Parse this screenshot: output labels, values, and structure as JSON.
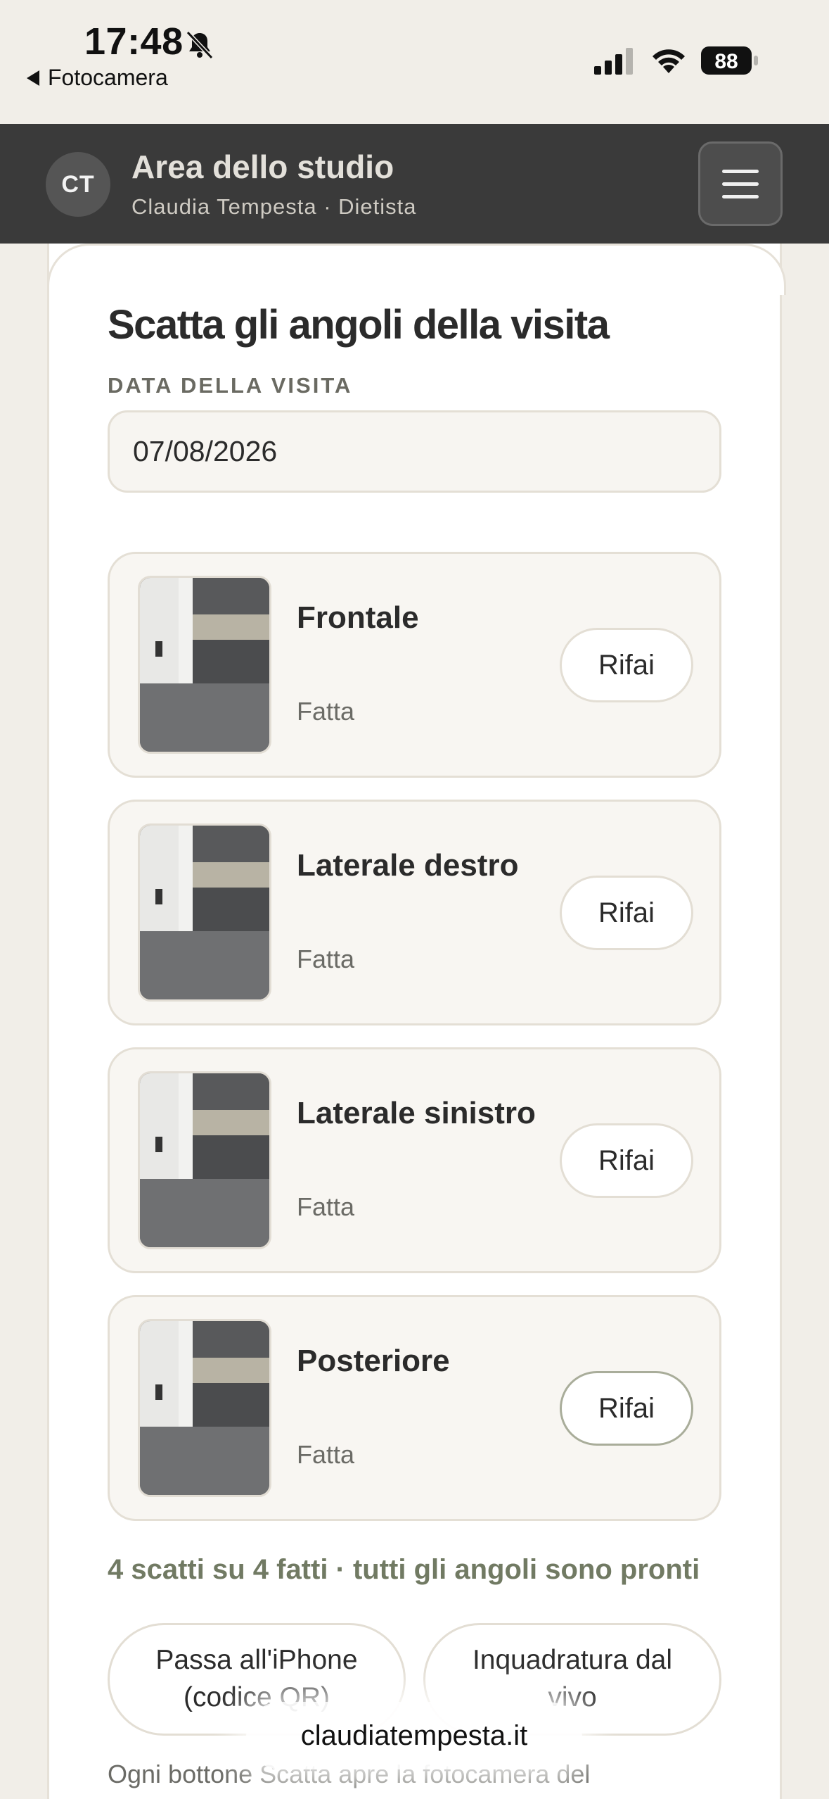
{
  "status_bar": {
    "time": "17:48",
    "back_label": "Fotocamera",
    "battery": "88",
    "icons": [
      "bell-slash-icon",
      "cellular-signal-icon",
      "wifi-icon",
      "battery-icon"
    ]
  },
  "header": {
    "avatar_initials": "CT",
    "title": "Area dello studio",
    "subtitle": "Claudia Tempesta · Dietista",
    "menu_icon": "hamburger-menu-icon",
    "background": "#3a3a3a"
  },
  "main": {
    "title": "Scatta gli angoli della visita",
    "date_label": "DATA DELLA VISITA",
    "date_value": "07/08/2026",
    "shots": [
      {
        "name": "Frontale",
        "status": "Fatta",
        "action": "Rifai"
      },
      {
        "name": "Laterale destro",
        "status": "Fatta",
        "action": "Rifai"
      },
      {
        "name": "Laterale sinistro",
        "status": "Fatta",
        "action": "Rifai"
      },
      {
        "name": "Posteriore",
        "status": "Fatta",
        "action": "Rifai"
      }
    ],
    "progress_text": "4 scatti su 4 fatti · tutti gli angoli sono pronti",
    "buttons": {
      "switch_iphone": "Passa all'iPhone (codice QR)",
      "live_framing": "Inquadratura dal vivo"
    },
    "help_text": "Ogni bottone Scatta apre la fotocamera del"
  },
  "browser": {
    "url": "claudiatempesta.it"
  },
  "colors": {
    "page_bg": "#f1eee8",
    "accent_text": "#717a63",
    "card_bg": "#ffffff"
  }
}
